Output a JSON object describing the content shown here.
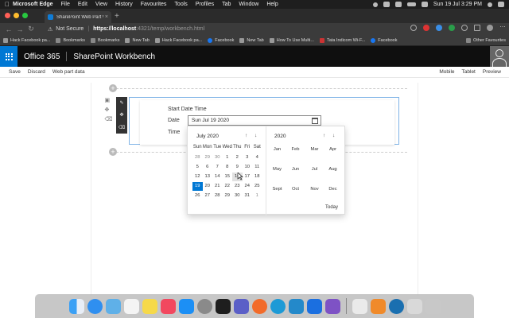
{
  "menubar": {
    "app_name": "Microsoft Edge",
    "items": [
      "File",
      "Edit",
      "View",
      "History",
      "Favourites",
      "Tools",
      "Profiles",
      "Tab",
      "Window",
      "Help"
    ],
    "clock": "Sun 19 Jul  3:29 PM"
  },
  "browser": {
    "tab_title": "SharePoint Web Part Workbench",
    "tab_close": "×",
    "new_tab": "+",
    "not_secure": "Not Secure",
    "url_scheme": "https://",
    "url_host": "localhost",
    "url_path": ":4321/temp/workbench.html"
  },
  "bookmarks": {
    "items": [
      {
        "label": "Hack Facebook pa...",
        "icon": "page-icon"
      },
      {
        "label": "Bookmarks",
        "icon": "folder-icon"
      },
      {
        "label": "Bookmarks",
        "icon": "folder-icon"
      },
      {
        "label": "New Tab",
        "icon": "page-icon"
      },
      {
        "label": "Hack Facebook pa...",
        "icon": "page-icon"
      },
      {
        "label": "Facebook",
        "icon": "facebook-icon"
      },
      {
        "label": "New Tab",
        "icon": "page-icon"
      },
      {
        "label": "How To Use Multi...",
        "icon": "page-icon"
      },
      {
        "label": "Tata Indicom Wi-F...",
        "icon": "tata-icon"
      },
      {
        "label": "Facebook",
        "icon": "facebook-icon"
      }
    ],
    "other": "Other Favourites"
  },
  "suite": {
    "product": "Office 365",
    "app": "SharePoint Workbench"
  },
  "command_bar": {
    "save": "Save",
    "discard": "Discard",
    "web_part_data": "Web part data",
    "mobile": "Mobile",
    "tablet": "Tablet",
    "preview": "Preview"
  },
  "webpart": {
    "title": "Start Date Time",
    "date_label": "Date",
    "time_label": "Time",
    "date_value": "Sun Jul 19 2020"
  },
  "calendar": {
    "month_label": "July 2020",
    "year_label": "2020",
    "nav_up": "↑",
    "nav_down": "↓",
    "weekdays": [
      "Sun",
      "Mon",
      "Tue",
      "Wed",
      "Thu",
      "Fri",
      "Sat"
    ],
    "weeks": [
      [
        "28",
        "29",
        "30",
        "1",
        "2",
        "3",
        "4"
      ],
      [
        "5",
        "6",
        "7",
        "8",
        "9",
        "10",
        "11"
      ],
      [
        "12",
        "13",
        "14",
        "15",
        "16",
        "17",
        "18"
      ],
      [
        "19",
        "20",
        "21",
        "22",
        "23",
        "24",
        "25"
      ],
      [
        "26",
        "27",
        "28",
        "29",
        "30",
        "31",
        "1"
      ]
    ],
    "selected_day": "19",
    "hovered_day": "16",
    "months": [
      "Jan",
      "Feb",
      "Mar",
      "Apr",
      "May",
      "Jun",
      "Jul",
      "Aug",
      "Sept",
      "Oct",
      "Nov",
      "Dec"
    ],
    "today": "Today"
  },
  "colors": {
    "accent": "#0078d4",
    "suite_bg": "#0f0f0f",
    "webpart_border": "#7fb3e6"
  },
  "dock": {
    "apps": [
      "finder-icon",
      "safari-icon",
      "preview-icon",
      "reminders-icon",
      "notes-icon",
      "music-icon",
      "app-store-icon",
      "system-preferences-icon",
      "terminal-icon",
      "teams-icon",
      "slack-icon",
      "edge-icon",
      "vscode-icon",
      "sourcetree-icon",
      "visual-studio-icon",
      "textedit-icon",
      "pages-icon",
      "edge-dev-icon",
      "screenshot-icon",
      "trash-icon"
    ]
  }
}
